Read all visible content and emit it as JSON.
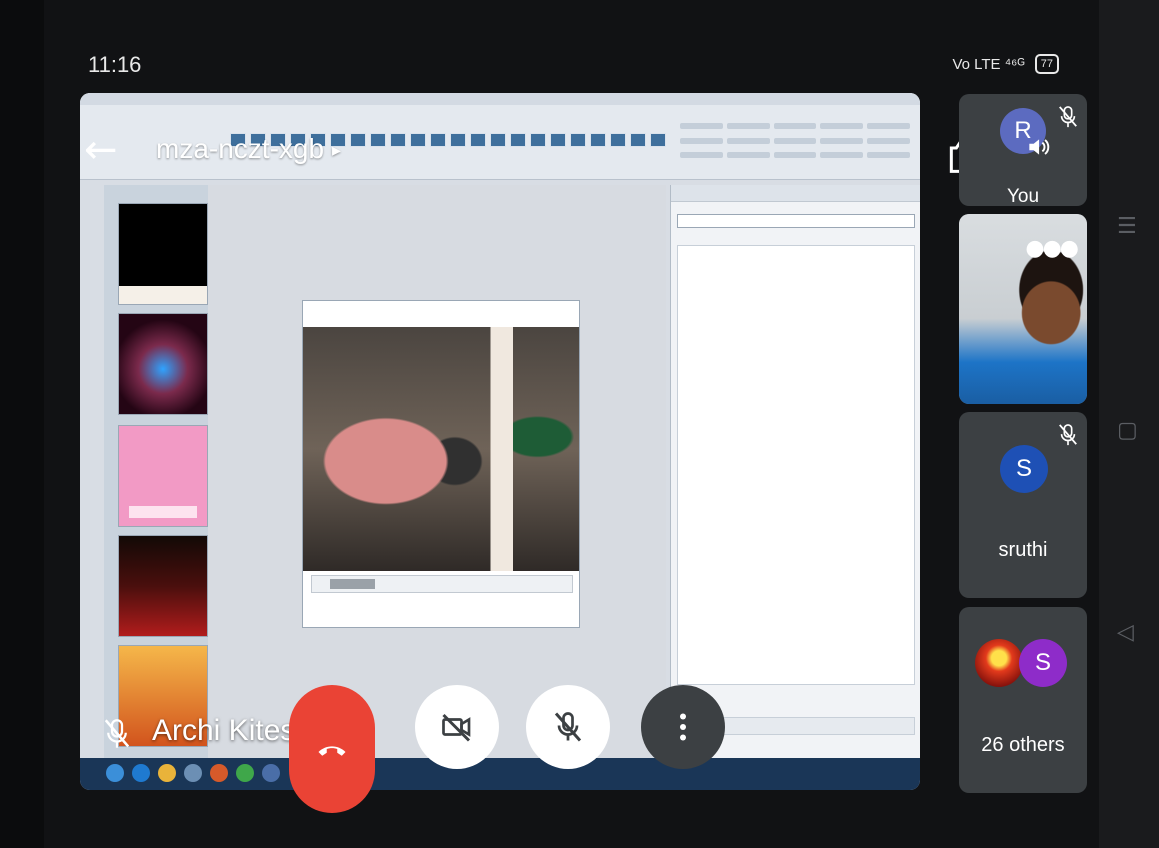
{
  "status_bar": {
    "time": "11:16",
    "network": "Vo LTE ⁴⁶ᴳ",
    "battery": "77"
  },
  "meeting": {
    "code": "mza-nczt-xgb",
    "presenter_name": "Archi Kites"
  },
  "controls": {
    "end_call": "end-call",
    "camera": "camera-off",
    "microphone": "mic-off",
    "more": "more-options"
  },
  "participants": {
    "you": {
      "initial": "R",
      "label": "You"
    },
    "sruthi": {
      "initial": "S",
      "label": "sruthi"
    },
    "others": {
      "initial": "S",
      "label": "26 others"
    }
  },
  "colors": {
    "end_call": "#ea4335",
    "tile_bg": "#3c4043",
    "avatar_r": "#5c6bc0",
    "avatar_sruthi": "#1e50b5",
    "avatar_others": "#8e2cc9"
  }
}
